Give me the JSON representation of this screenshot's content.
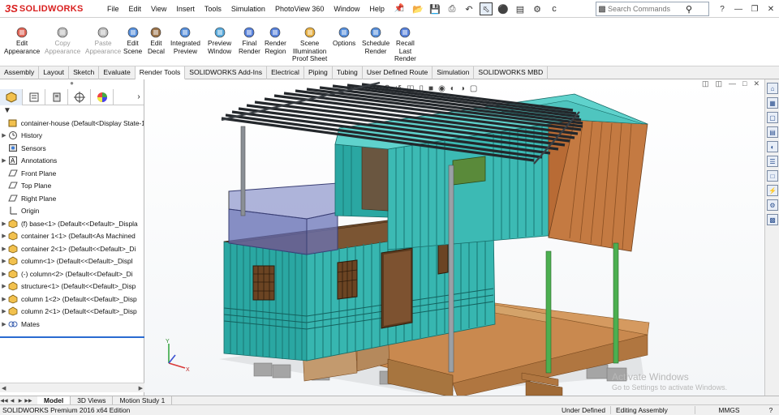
{
  "app": {
    "logo_ds": "3S",
    "logo_name": "SOLIDWORKS"
  },
  "menu": [
    "File",
    "Edit",
    "View",
    "Insert",
    "Tools",
    "Simulation",
    "PhotoView 360",
    "Window",
    "Help"
  ],
  "search": {
    "placeholder": "Search Commands"
  },
  "ribbon": [
    {
      "label": "Edit\nAppearance",
      "icon": "edit-appearance-icon",
      "enabled": true
    },
    {
      "label": "Copy\nAppearance",
      "icon": "copy-appearance-icon",
      "enabled": false
    },
    {
      "label": "Paste\nAppearance",
      "icon": "paste-appearance-icon",
      "enabled": false
    },
    {
      "label": "Edit\nScene",
      "icon": "edit-scene-icon",
      "enabled": true
    },
    {
      "label": "Edit\nDecal",
      "icon": "edit-decal-icon",
      "enabled": true
    },
    {
      "label": "Integrated\nPreview",
      "icon": "integrated-preview-icon",
      "enabled": true
    },
    {
      "label": "Preview\nWindow",
      "icon": "preview-window-icon",
      "enabled": true
    },
    {
      "label": "Final\nRender",
      "icon": "final-render-icon",
      "enabled": true
    },
    {
      "label": "Render\nRegion",
      "icon": "render-region-icon",
      "enabled": true
    },
    {
      "label": "Scene\nIllumination\nProof Sheet",
      "icon": "illumination-proof-icon",
      "enabled": true
    },
    {
      "label": "Options",
      "icon": "options-icon",
      "enabled": true
    },
    {
      "label": "Schedule\nRender",
      "icon": "schedule-render-icon",
      "enabled": true
    },
    {
      "label": "Recall\nLast\nRender",
      "icon": "recall-render-icon",
      "enabled": true
    }
  ],
  "tabs": [
    {
      "label": "Assembly",
      "active": false
    },
    {
      "label": "Layout",
      "active": false
    },
    {
      "label": "Sketch",
      "active": false
    },
    {
      "label": "Evaluate",
      "active": false
    },
    {
      "label": "Render Tools",
      "active": true
    },
    {
      "label": "SOLIDWORKS Add-Ins",
      "active": false
    },
    {
      "label": "Electrical",
      "active": false
    },
    {
      "label": "Piping",
      "active": false
    },
    {
      "label": "Tubing",
      "active": false
    },
    {
      "label": "User Defined Route",
      "active": false
    },
    {
      "label": "Simulation",
      "active": false
    },
    {
      "label": "SOLIDWORKS MBD",
      "active": false
    }
  ],
  "tree": [
    {
      "label": "container-house  (Default<Display State-1>",
      "icon": "assembly-icon",
      "expander": false,
      "root": true
    },
    {
      "label": "History",
      "icon": "history-icon",
      "expander": true
    },
    {
      "label": "Sensors",
      "icon": "sensors-icon",
      "expander": false
    },
    {
      "label": "Annotations",
      "icon": "annotations-icon",
      "expander": true
    },
    {
      "label": "Front Plane",
      "icon": "plane-icon",
      "expander": false
    },
    {
      "label": "Top Plane",
      "icon": "plane-icon",
      "expander": false
    },
    {
      "label": "Right Plane",
      "icon": "plane-icon",
      "expander": false
    },
    {
      "label": "Origin",
      "icon": "origin-icon",
      "expander": false
    },
    {
      "label": "(f) base<1> (Default<<Default>_Displa",
      "icon": "part-icon",
      "expander": true
    },
    {
      "label": "container 1<1> (Default<As Machined",
      "icon": "part-icon",
      "expander": true
    },
    {
      "label": "container 2<1> (Default<<Default>_Di",
      "icon": "part-icon",
      "expander": true
    },
    {
      "label": "column<1> (Default<<Default>_Displ",
      "icon": "part-icon",
      "expander": true
    },
    {
      "label": "(-) column<2> (Default<<Default>_Di",
      "icon": "part-icon",
      "expander": true
    },
    {
      "label": "structure<1> (Default<<Default>_Disp",
      "icon": "part-icon",
      "expander": true
    },
    {
      "label": "column 1<2> (Default<<Default>_Disp",
      "icon": "part-icon",
      "expander": true
    },
    {
      "label": "column 2<1> (Default<<Default>_Disp",
      "icon": "part-icon",
      "expander": true
    },
    {
      "label": "Mates",
      "icon": "mates-icon",
      "expander": true
    }
  ],
  "watermark": {
    "line1": "Activate Windows",
    "line2": "Go to Settings to activate Windows."
  },
  "bottom_tabs": [
    {
      "label": "Model",
      "active": true
    },
    {
      "label": "3D Views",
      "active": false
    },
    {
      "label": "Motion Study 1",
      "active": false
    }
  ],
  "status": {
    "app_version": "SOLIDWORKS Premium 2016 x64 Edition",
    "definition": "Under Defined",
    "mode": "Editing Assembly",
    "units": "MMGS"
  },
  "colors": {
    "brand": "#d9201f",
    "container": "#37b6b0",
    "container_dark": "#1f8a86",
    "roof_beams": "#2b2f33",
    "wood": "#b86b35",
    "deck_wood": "#c9894f",
    "glass": "#6a74b8",
    "column_green": "#4caf50",
    "foundation": "#9a9a9a"
  }
}
